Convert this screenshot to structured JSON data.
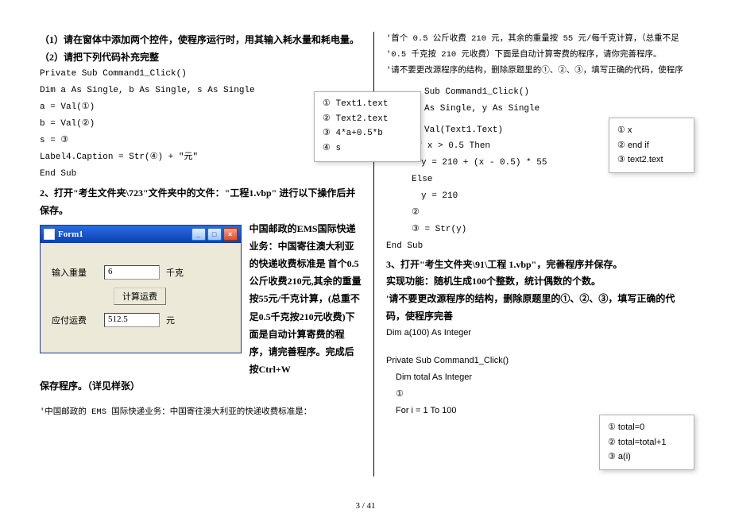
{
  "footer": "3 / 41",
  "left": {
    "q1": "（1）请在窗体中添加两个控件，使程序运行时，用其输入耗水量和耗电量。",
    "q2": "（2）请把下列代码补充完整",
    "code": {
      "l1": "Private Sub Command1_Click()",
      "l2": "Dim a As Single, b As Single, s As Single",
      "l3": "a = Val(①)",
      "l4": "b = Val(②)",
      "l5": "s = ③",
      "l6": "Label4.Caption = Str(④) + \"元\"",
      "l7": "End Sub"
    },
    "task2": "2、打开\"考生文件夹\\723\"文件夹中的文件：\"工程1.vbp\"  进行以下操作后并保存。",
    "form": {
      "title": "Form1",
      "label_weight": "输入重量",
      "weight_value": "6",
      "unit_kg": "千克",
      "btn_calc": "计算运费",
      "label_fee": "应付运费",
      "fee_value": "512.5",
      "unit_yuan": "元"
    },
    "desc_right": "中国邮政的EMS国际快递业务：中国寄往澳大利亚的快递收费标准是 首个0.5公斤收费210元,其余的重量按55元/千克计算，(总重不足0.5千克按210元收费)下面是自动计算寄费的程序，请完善程序。完成后按Ctrl+W",
    "save_line": "保存程序。（详见样张）",
    "quote": "'中国邮政的 EMS 国际快递业务：中国寄往澳大利亚的快递收费标准是：",
    "hint": {
      "h1": "① Text1.text",
      "h2": "② Text2.text",
      "h3": "③ 4*a+0.5*b",
      "h4": "④ s"
    }
  },
  "right": {
    "c1": "'首个 0.5 公斤收费 210 元，其余的重量按 55 元/每千克计算，（总重不足",
    "c2": "'0.5 千克按 210 元收费）下面是自动计算寄费的程序，请你完善程序。",
    "c3": "'请不要更改源程序的结构，删除原题里的①、②、③，填写正确的代码，使程序",
    "code": {
      "l1": "Sub Command1_Click()",
      "l2": "As Single, y As Single",
      "l3_pre": "Val(Text1.Text)",
      "l4": "If x > 0.5 Then",
      "l5": "  y = 210 + (x - 0.5) * 55",
      "l6": "Else",
      "l7": "  y = 210",
      "l8": "②",
      "l9": "③ = Str(y)",
      "l10": "End Sub"
    },
    "task3": "3、打开\"考生文件夹\\91\\工程 1.vbp\"，完善程序并保存。",
    "task3b": "实现功能：随机生成100个整数，统计偶数的个数。",
    "task3c": "'请不要更改源程序的结构，删除原题里的①、②、③，填写正确的代码，使程序完善",
    "code2": {
      "l1": "Dim a(100) As Integer",
      "l2": "Private Sub Command1_Click()",
      "l3": "  Dim total As Integer",
      "l4": "  ①",
      "l5": "  For i = 1 To 100"
    },
    "hint1": {
      "h1": "① x",
      "h2": "② end if",
      "h3": "③ text2.text"
    },
    "hint2": {
      "h1": "① total=0",
      "h2": "② total=total+1",
      "h3": "③ a(i)"
    }
  }
}
